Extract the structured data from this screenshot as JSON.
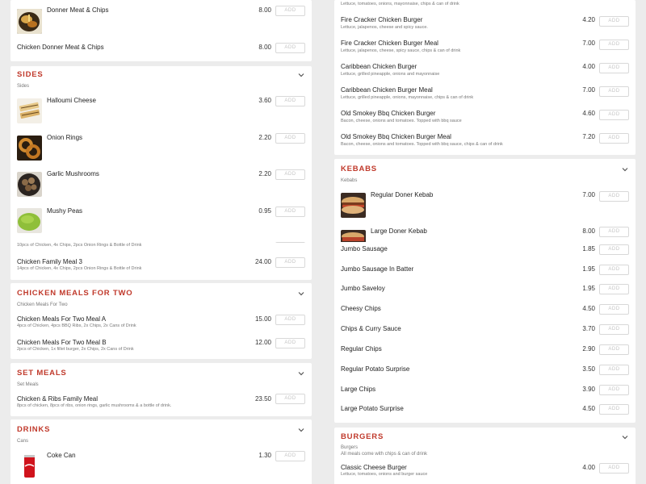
{
  "tl": {
    "items": [
      {
        "name": "Donner Meat & Chips",
        "price": "8.00"
      },
      {
        "name": "Chicken Donner Meat & Chips",
        "price": "8.00"
      }
    ],
    "sides": {
      "title": "SIDES",
      "subtitle": "Sides",
      "items": [
        {
          "name": "Halloumi Cheese",
          "price": "3.60"
        },
        {
          "name": "Onion Rings",
          "price": "2.20"
        },
        {
          "name": "Garlic Mushrooms",
          "price": "2.20"
        },
        {
          "name": "Mushy Peas",
          "price": "0.95"
        }
      ]
    },
    "add_label": "ADD"
  },
  "tr": {
    "top_desc": "Lettuce, tomatoes, onions, mayonnaise, chips & can of drink",
    "items": [
      {
        "name": "Fire Cracker Chicken Burger",
        "desc": "Lettuce, jalapenos, cheese and spicy sauce.",
        "price": "4.20"
      },
      {
        "name": "Fire Cracker Chicken Burger Meal",
        "desc": "Lettuce, jalapenos, cheese, spicy sauce, chips & can of drink",
        "price": "7.00"
      },
      {
        "name": "Caribbean Chicken Burger",
        "desc": "Lettuce, grilled pineapple, onions and mayonnaise",
        "price": "4.00"
      },
      {
        "name": "Caribbean Chicken Burger Meal",
        "desc": "Lettuce, grilled pineapple, onions, mayonnaise, chips & can of drink",
        "price": "7.00"
      },
      {
        "name": "Old Smokey Bbq Chicken Burger",
        "desc": "Bacon, cheese, onions and tomatoes. Topped with bbq sauce",
        "price": "4.60"
      },
      {
        "name": "Old Smokey Bbq Chicken Burger Meal",
        "desc": "Bacon, cheese, onions and tomatoes. Topped with bbq sauce, chips & can of drink",
        "price": "7.20"
      }
    ],
    "kebabs": {
      "title": "KEBABS",
      "subtitle": "Kebabs",
      "items": [
        {
          "name": "Regular Doner Kebab",
          "price": "7.00"
        },
        {
          "name": "Large Doner Kebab",
          "price": "8.00"
        }
      ]
    }
  },
  "bl": {
    "top_desc": "10pcs of Chicken, 4x Chips, 2pcs Onion Rings & Bottle of Drink",
    "family": {
      "name": "Chicken Family Meal 3",
      "desc": "14pcs of Chicken, 4x Chips, 2pcs Onion Rings & Bottle of Drink",
      "price": "24.00"
    },
    "two": {
      "title": "CHICKEN MEALS FOR TWO",
      "subtitle": "Chicken Meals For Two",
      "items": [
        {
          "name": "Chicken Meals For Two Meal A",
          "desc": "4pcs of Chicken, 4pcs BBQ Ribs, 2x Chips, 2x Cans of Drink",
          "price": "15.00"
        },
        {
          "name": "Chicken Meals For Two Meal B",
          "desc": "2pcs of Chicken, 1x fillet burger, 2x Chips, 2x Cans of Drink",
          "price": "12.00"
        }
      ]
    },
    "set": {
      "title": "SET MEALS",
      "subtitle": "Set Meals",
      "items": [
        {
          "name": "Chicken & Ribs Family Meal",
          "desc": "8pcs of chicken, 8pcs of ribs, onion rings, garlic mushrooms & a bottle of drink.",
          "price": "23.50"
        }
      ]
    },
    "drinks": {
      "title": "DRINKS",
      "subtitle": "Cans",
      "items": [
        {
          "name": "Coke Can",
          "price": "1.30"
        }
      ]
    }
  },
  "br": {
    "items": [
      {
        "name": "Jumbo Sausage",
        "price": "1.85"
      },
      {
        "name": "Jumbo Sausage In Batter",
        "price": "1.95"
      },
      {
        "name": "Jumbo Saveloy",
        "price": "1.95"
      },
      {
        "name": "Cheesy Chips",
        "price": "4.50"
      },
      {
        "name": "Chips & Curry Sauce",
        "price": "3.70"
      },
      {
        "name": "Regular Chips",
        "price": "2.90"
      },
      {
        "name": "Regular Potato Surprise",
        "price": "3.50"
      },
      {
        "name": "Large Chips",
        "price": "3.90"
      },
      {
        "name": "Large Potato Surprise",
        "price": "4.50"
      }
    ],
    "burgers": {
      "title": "BURGERS",
      "subtitle": "Burgers",
      "subtitle2": "All meals come with chips & can of drink",
      "items": [
        {
          "name": "Classic Cheese Burger",
          "desc": "Lettuce, tomatoes, onions and burger sauce",
          "price": "4.00"
        }
      ]
    }
  },
  "colors": {
    "accent": "#c0392b",
    "background": "#ececec",
    "card": "#ffffff"
  },
  "icons": {
    "chevron": "chevron-down-icon"
  }
}
